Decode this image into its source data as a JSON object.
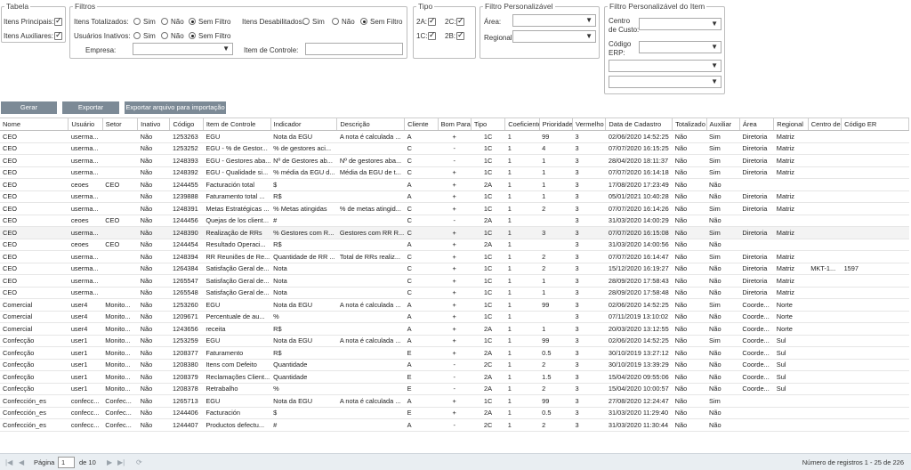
{
  "filters": {
    "tabela": {
      "legend": "Tabela",
      "itens_principais": "Itens Principais:",
      "itens_auxiliares": "Itens Auxiliares:"
    },
    "filtros": {
      "legend": "Filtros",
      "itens_totalizados": "Itens Totalizados:",
      "usuarios_inativos": "Usuários Inativos:",
      "itens_desabilitados": "Itens Desabilitados:",
      "sim": "Sim",
      "nao": "Não",
      "sem_filtro": "Sem Filtro",
      "empresa": "Empresa:",
      "item_de_controle": "Item de Controle:"
    },
    "tipo": {
      "legend": "Tipo",
      "t2a": "2A:",
      "t2c": "2C:",
      "t1c": "1C:",
      "t2b": "2B:"
    },
    "personalizavel": {
      "legend": "Filtro Personalizável",
      "area": "Área:",
      "regional": "Regional:"
    },
    "personalizavel_item": {
      "legend": "Filtro Personalizável do Item",
      "centro_l1": "Centro",
      "centro_l2": "de Custo:",
      "codigo_l1": "Código",
      "codigo_l2": "ERP:"
    }
  },
  "buttons": {
    "gerar": "Gerar",
    "exportar": "Exportar",
    "exportar_arquivo": "Exportar arquivo para importação"
  },
  "columns": [
    "Nome",
    "Usuário",
    "Setor",
    "Inativo",
    "Código",
    "Item de Controle",
    "Indicador",
    "Descrição",
    "Cliente",
    "Bom Para",
    "Tipo",
    "Coeficiente",
    "Prioridade",
    "Vermelho",
    "Data de Cadastro",
    "Totalizado",
    "Auxiliar",
    "Área",
    "Regional",
    "Centro de",
    "Código ER"
  ],
  "rows": [
    [
      "CEO",
      "userma...",
      "",
      "Não",
      "1253263",
      "EGU",
      "Nota da EGU",
      "A nota é calculada ...",
      "A",
      "+",
      "1C",
      "1",
      "99",
      "3",
      "02/06/2020 14:52:25",
      "Não",
      "Sim",
      "Diretoria",
      "Matriz",
      "",
      ""
    ],
    [
      "CEO",
      "userma...",
      "",
      "Não",
      "1253252",
      "EGU - % de Gestor...",
      "% de gestores aci...",
      "",
      "C",
      "-",
      "1C",
      "1",
      "4",
      "3",
      "07/07/2020 16:15:25",
      "Não",
      "Sim",
      "Diretoria",
      "Matriz",
      "",
      ""
    ],
    [
      "CEO",
      "userma...",
      "",
      "Não",
      "1248393",
      "EGU - Gestores aba...",
      "Nº de Gestores ab...",
      "Nº de gestores aba...",
      "C",
      "-",
      "1C",
      "1",
      "1",
      "3",
      "28/04/2020 18:11:37",
      "Não",
      "Sim",
      "Diretoria",
      "Matriz",
      "",
      ""
    ],
    [
      "CEO",
      "userma...",
      "",
      "Não",
      "1248392",
      "EGU - Qualidade si...",
      "% média da EGU d...",
      "Média da EGU de t...",
      "C",
      "+",
      "1C",
      "1",
      "1",
      "3",
      "07/07/2020 16:14:18",
      "Não",
      "Sim",
      "Diretoria",
      "Matriz",
      "",
      ""
    ],
    [
      "CEO",
      "ceoes",
      "CEO",
      "Não",
      "1244455",
      "Facturación total",
      "$",
      "",
      "A",
      "+",
      "2A",
      "1",
      "1",
      "3",
      "17/08/2020 17:23:49",
      "Não",
      "Não",
      "",
      "",
      "",
      ""
    ],
    [
      "CEO",
      "userma...",
      "",
      "Não",
      "1239888",
      "Faturamento total ...",
      "R$",
      "",
      "A",
      "+",
      "1C",
      "1",
      "1",
      "3",
      "05/01/2021 10:40:28",
      "Não",
      "Não",
      "Diretoria",
      "Matriz",
      "",
      ""
    ],
    [
      "CEO",
      "userma...",
      "",
      "Não",
      "1248391",
      "Metas Estratégicas ...",
      "% Metas atingidas",
      "% de metas atingid...",
      "C",
      "+",
      "1C",
      "1",
      "2",
      "3",
      "07/07/2020 16:14:26",
      "Não",
      "Sim",
      "Diretoria",
      "Matriz",
      "",
      ""
    ],
    [
      "CEO",
      "ceoes",
      "CEO",
      "Não",
      "1244456",
      "Quejas de los client...",
      "#",
      "",
      "C",
      "-",
      "2A",
      "1",
      "",
      "3",
      "31/03/2020 14:00:29",
      "Não",
      "Não",
      "",
      "",
      "",
      ""
    ],
    [
      "CEO",
      "userma...",
      "",
      "Não",
      "1248390",
      "Realização de RRs",
      "% Gestores com R...",
      "Gestores com RR R...",
      "C",
      "+",
      "1C",
      "1",
      "3",
      "3",
      "07/07/2020 16:15:08",
      "Não",
      "Sim",
      "Diretoria",
      "Matriz",
      "",
      ""
    ],
    [
      "CEO",
      "ceoes",
      "CEO",
      "Não",
      "1244454",
      "Resultado Operaci...",
      "R$",
      "",
      "A",
      "+",
      "2A",
      "1",
      "",
      "3",
      "31/03/2020 14:00:56",
      "Não",
      "Não",
      "",
      "",
      "",
      ""
    ],
    [
      "CEO",
      "userma...",
      "",
      "Não",
      "1248394",
      "RR Reuniões de Re...",
      "Quantidade de RR ...",
      "Total de RRs realiz...",
      "C",
      "+",
      "1C",
      "1",
      "2",
      "3",
      "07/07/2020 16:14:47",
      "Não",
      "Sim",
      "Diretoria",
      "Matriz",
      "",
      ""
    ],
    [
      "CEO",
      "userma...",
      "",
      "Não",
      "1264384",
      "Satisfação Geral de...",
      "Nota",
      "",
      "C",
      "+",
      "1C",
      "1",
      "2",
      "3",
      "15/12/2020 16:19:27",
      "Não",
      "Não",
      "Diretoria",
      "Matriz",
      "MKT-1...",
      "1597"
    ],
    [
      "CEO",
      "userma...",
      "",
      "Não",
      "1265547",
      "Satisfação Geral de...",
      "Nota",
      "",
      "C",
      "+",
      "1C",
      "1",
      "1",
      "3",
      "28/09/2020 17:58:43",
      "Não",
      "Não",
      "Diretoria",
      "Matriz",
      "",
      ""
    ],
    [
      "CEO",
      "userma...",
      "",
      "Não",
      "1265548",
      "Satisfação Geral de...",
      "Nota",
      "",
      "C",
      "+",
      "1C",
      "1",
      "1",
      "3",
      "28/09/2020 17:58:48",
      "Não",
      "Não",
      "Diretoria",
      "Matriz",
      "",
      ""
    ],
    [
      "Comercial",
      "user4",
      "Monito...",
      "Não",
      "1253260",
      "EGU",
      "Nota da EGU",
      "A nota é calculada ...",
      "A",
      "+",
      "1C",
      "1",
      "99",
      "3",
      "02/06/2020 14:52:25",
      "Não",
      "Sim",
      "Coorde...",
      "Norte",
      "",
      ""
    ],
    [
      "Comercial",
      "user4",
      "Monito...",
      "Não",
      "1209671",
      "Percentuale de au...",
      "%",
      "",
      "A",
      "+",
      "1C",
      "1",
      "",
      "3",
      "07/11/2019 13:10:02",
      "Não",
      "Não",
      "Coorde...",
      "Norte",
      "",
      ""
    ],
    [
      "Comercial",
      "user4",
      "Monito...",
      "Não",
      "1243656",
      "receita",
      "R$",
      "",
      "A",
      "+",
      "2A",
      "1",
      "1",
      "3",
      "20/03/2020 13:12:55",
      "Não",
      "Não",
      "Coorde...",
      "Norte",
      "",
      ""
    ],
    [
      "Confecção",
      "user1",
      "Monito...",
      "Não",
      "1253259",
      "EGU",
      "Nota da EGU",
      "A nota é calculada ...",
      "A",
      "+",
      "1C",
      "1",
      "99",
      "3",
      "02/06/2020 14:52:25",
      "Não",
      "Sim",
      "Coorde...",
      "Sul",
      "",
      ""
    ],
    [
      "Confecção",
      "user1",
      "Monito...",
      "Não",
      "1208377",
      "Faturamento",
      "R$",
      "",
      "E",
      "+",
      "2A",
      "1",
      "0.5",
      "3",
      "30/10/2019 13:27:12",
      "Não",
      "Não",
      "Coorde...",
      "Sul",
      "",
      ""
    ],
    [
      "Confecção",
      "user1",
      "Monito...",
      "Não",
      "1208380",
      "Itens com Defeito",
      "Quantidade",
      "",
      "A",
      "-",
      "2C",
      "1",
      "2",
      "3",
      "30/10/2019 13:39:29",
      "Não",
      "Não",
      "Coorde...",
      "Sul",
      "",
      ""
    ],
    [
      "Confecção",
      "user1",
      "Monito...",
      "Não",
      "1208379",
      "Reclamações Client...",
      "Quantidade",
      "",
      "E",
      "-",
      "2A",
      "1",
      "1.5",
      "3",
      "15/04/2020 09:55:06",
      "Não",
      "Não",
      "Coorde...",
      "Sul",
      "",
      ""
    ],
    [
      "Confecção",
      "user1",
      "Monito...",
      "Não",
      "1208378",
      "Retrabalho",
      "%",
      "",
      "E",
      "-",
      "2A",
      "1",
      "2",
      "3",
      "15/04/2020 10:00:57",
      "Não",
      "Não",
      "Coorde...",
      "Sul",
      "",
      ""
    ],
    [
      "Confección_es",
      "confecc...",
      "Confec...",
      "Não",
      "1265713",
      "EGU",
      "Nota da EGU",
      "A nota é calculada ...",
      "A",
      "+",
      "1C",
      "1",
      "99",
      "3",
      "27/08/2020 12:24:47",
      "Não",
      "Sim",
      "",
      "",
      "",
      ""
    ],
    [
      "Confección_es",
      "confecc...",
      "Confec...",
      "Não",
      "1244406",
      "Facturación",
      "$",
      "",
      "E",
      "+",
      "2A",
      "1",
      "0.5",
      "3",
      "31/03/2020 11:29:40",
      "Não",
      "Não",
      "",
      "",
      "",
      ""
    ],
    [
      "Confección_es",
      "confecc...",
      "Confec...",
      "Não",
      "1244407",
      "Productos defectu...",
      "#",
      "",
      "A",
      "-",
      "2C",
      "1",
      "2",
      "3",
      "31/03/2020 11:30:44",
      "Não",
      "Não",
      "",
      "",
      "",
      ""
    ]
  ],
  "pager": {
    "pagina": "Página",
    "page_value": "1",
    "de": "de 10",
    "registros": "Número de registros 1 - 25 de 226"
  }
}
